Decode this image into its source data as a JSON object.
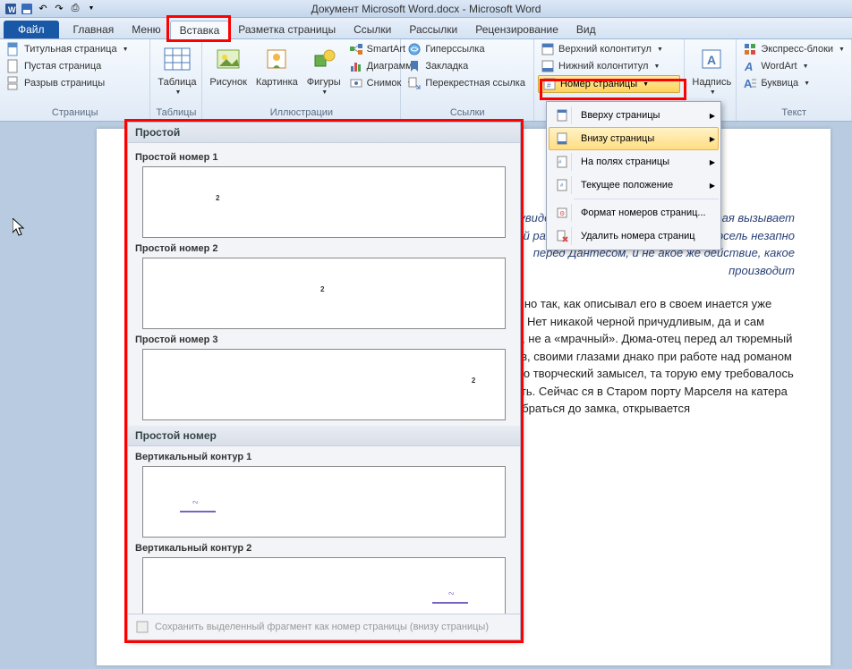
{
  "window_title": "Документ Microsoft Word.docx - Microsoft Word",
  "tabs": {
    "file": "Файл",
    "home": "Главная",
    "menu": "Меню",
    "insert": "Вставка",
    "page_layout": "Разметка страницы",
    "references": "Ссылки",
    "mailings": "Рассылки",
    "review": "Рецензирование",
    "view": "Вид"
  },
  "ribbon": {
    "pages": {
      "cover": "Титульная страница",
      "blank": "Пустая страница",
      "break": "Разрыв страницы",
      "group": "Страницы"
    },
    "tables": {
      "table": "Таблица",
      "group": "Таблицы"
    },
    "illustrations": {
      "picture": "Рисунок",
      "clipart": "Картинка",
      "shapes": "Фигуры",
      "smartart": "SmartArt",
      "chart": "Диаграмма",
      "screenshot": "Снимок",
      "group": "Иллюстрации"
    },
    "links": {
      "hyperlink": "Гиперссылка",
      "bookmark": "Закладка",
      "crossref": "Перекрестная ссылка",
      "group": "Ссылки"
    },
    "header_footer": {
      "header": "Верхний колонтитул",
      "footer": "Нижний колонтитул",
      "page_number": "Номер страницы"
    },
    "text_group": {
      "textbox": "Надпись",
      "quick_parts": "Экспресс-блоки",
      "wordart": "WordArt",
      "dropcap": "Буквица",
      "group": "Текст"
    }
  },
  "page_num_menu": {
    "top": "Вверху страницы",
    "bottom": "Внизу страницы",
    "margins": "На полях страницы",
    "current": "Текущее положение",
    "format": "Формат номеров страниц...",
    "remove": "Удалить номера страниц"
  },
  "gallery": {
    "section1": "Простой",
    "item1": "Простой номер 1",
    "item2": "Простой номер 2",
    "item3": "Простой номер 3",
    "section2": "Простой номер",
    "item4": "Вертикальный контур 1",
    "item5": "Вертикальный контур 2",
    "preview_num": "2",
    "footer": "Сохранить выделенный фрагмент как номер страницы (внизу страницы)"
  },
  "document": {
    "p1": "и увидел в ся мрачный тюрьма, которая вызывает такой рая уже триста лет питает Марсель незапно перед Дантесом, и не акое же действие, какое производит",
    "p2": ", именно так, как описывал его в своем инается уже здесь. Нет никакой черной причудливым, да и сам замок, не а «мрачный». Дюма-отец перед ал тюремный остров, своими глазами днако при работе над романом вал его творческий замысел, та торую ему требовалось создать. Сейчас ся в Старом порту Марселя на катера бы добраться до замка, открывается"
  }
}
